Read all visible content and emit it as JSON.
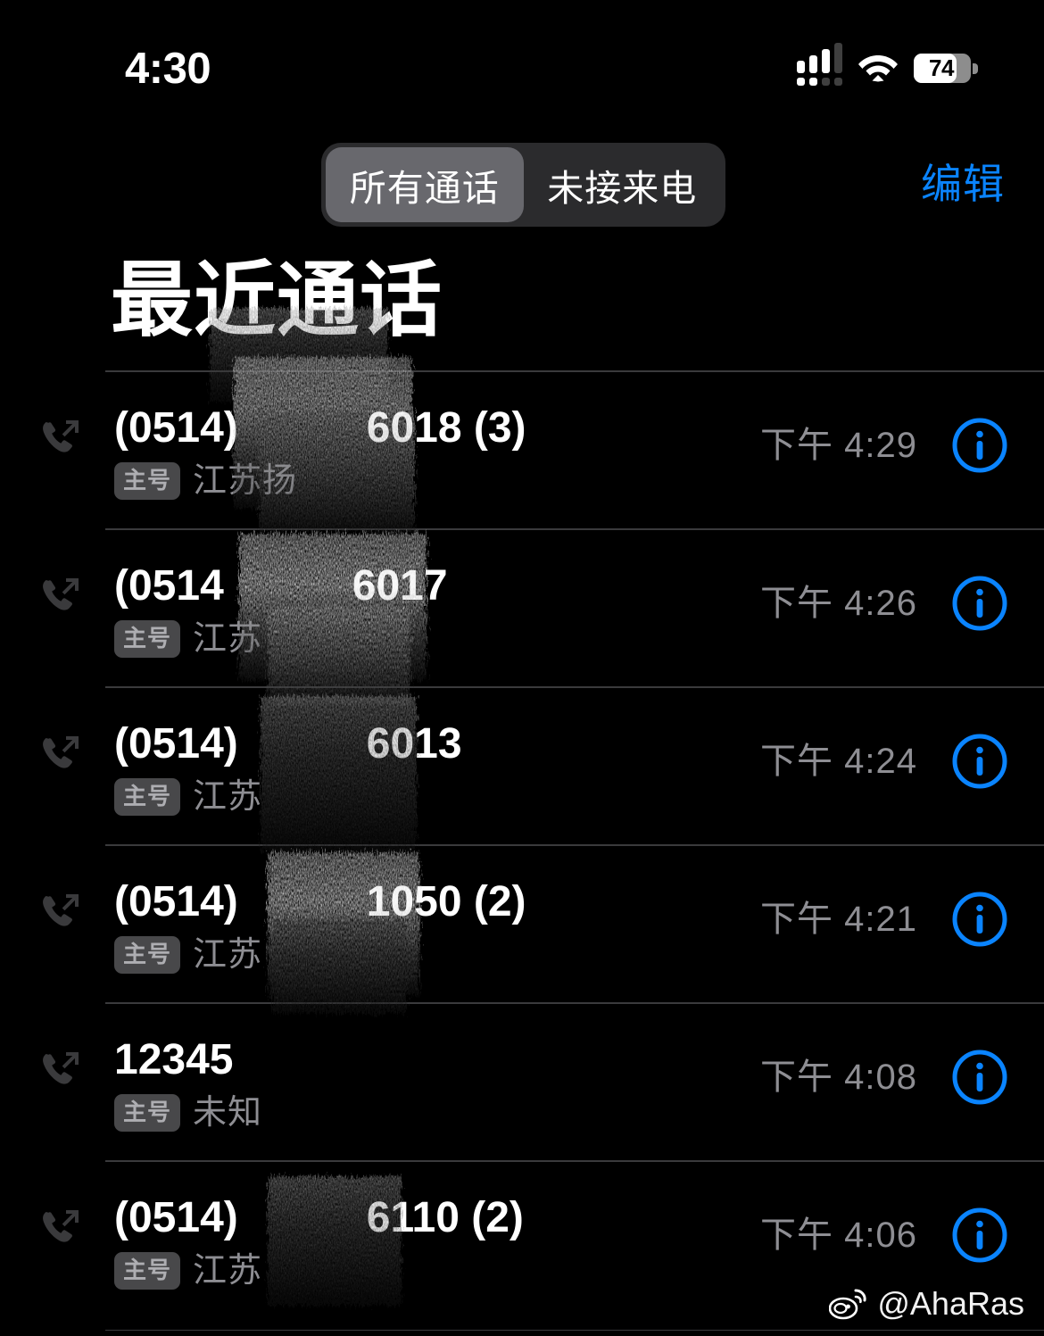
{
  "status_bar": {
    "time": "4:30",
    "battery_percent": "74",
    "signal_icon": "cellular-signal-icon",
    "wifi_icon": "wifi-icon",
    "battery_icon": "battery-icon"
  },
  "navbar": {
    "segments": [
      {
        "label": "所有通话",
        "selected": true
      },
      {
        "label": "未接来电",
        "selected": false
      }
    ],
    "edit_label": "编辑"
  },
  "page": {
    "title": "最近通话"
  },
  "colors": {
    "accent_blue": "#0a84ff",
    "background": "#000000",
    "secondary_text": "#8e8e93",
    "separator": "#3a3a3c",
    "segment_track": "#2b2b2d",
    "segment_selected": "#68686d",
    "badge_bg": "#48484a",
    "call_icon": "#3a3a3c"
  },
  "calls": [
    {
      "number": "(0514)　　　6018 (3)",
      "badge": "主号",
      "location": "江苏扬",
      "time": "下午 4:29",
      "call_type_icon": "outgoing-call-icon",
      "info_icon": "info-circle-icon",
      "redacted": true
    },
    {
      "number": "(0514　　　6017",
      "badge": "主号",
      "location": "江苏",
      "time": "下午 4:26",
      "call_type_icon": "outgoing-call-icon",
      "info_icon": "info-circle-icon",
      "redacted": true
    },
    {
      "number": "(0514)　　　6013",
      "badge": "主号",
      "location": "江苏",
      "time": "下午 4:24",
      "call_type_icon": "outgoing-call-icon",
      "info_icon": "info-circle-icon",
      "redacted": true
    },
    {
      "number": "(0514)　　　1050 (2)",
      "badge": "主号",
      "location": "江苏",
      "time": "下午 4:21",
      "call_type_icon": "outgoing-call-icon",
      "info_icon": "info-circle-icon",
      "redacted": true
    },
    {
      "number": "12345",
      "badge": "主号",
      "location": "未知",
      "time": "下午 4:08",
      "call_type_icon": "outgoing-call-icon",
      "info_icon": "info-circle-icon",
      "redacted": false
    },
    {
      "number": "(0514)　　　6110 (2)",
      "badge": "主号",
      "location": "江苏",
      "time": "下午 4:06",
      "call_type_icon": "outgoing-call-icon",
      "info_icon": "info-circle-icon",
      "redacted": true
    }
  ],
  "watermark": {
    "handle": "@AhaRas",
    "logo_icon": "weibo-logo-icon"
  }
}
